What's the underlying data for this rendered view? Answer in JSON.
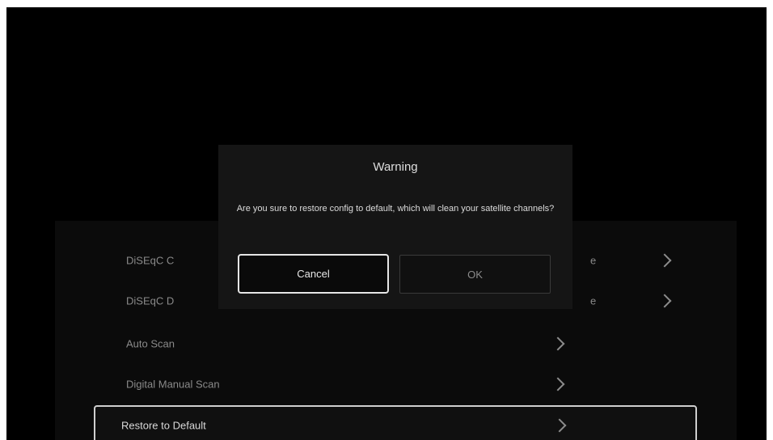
{
  "menu": {
    "items": [
      {
        "label": "DiSEqC C",
        "value": "e"
      },
      {
        "label": "DiSEqC D",
        "value": "e"
      },
      {
        "label": "Auto Scan"
      },
      {
        "label": "Digital Manual Scan"
      },
      {
        "label": "Restore to Default",
        "focused": true
      }
    ]
  },
  "dialog": {
    "title": "Warning",
    "message": "Are you sure to restore config to default, which will clean your satellite channels?",
    "cancel_label": "Cancel",
    "ok_label": "OK",
    "focused_button": "Cancel"
  },
  "colors": {
    "screen_background": "#000000",
    "dialog_background": "#151515",
    "focus_border": "#e6e6e6",
    "muted_text": "#8a8a8a"
  },
  "icons": [
    "chevron-right-icon"
  ]
}
